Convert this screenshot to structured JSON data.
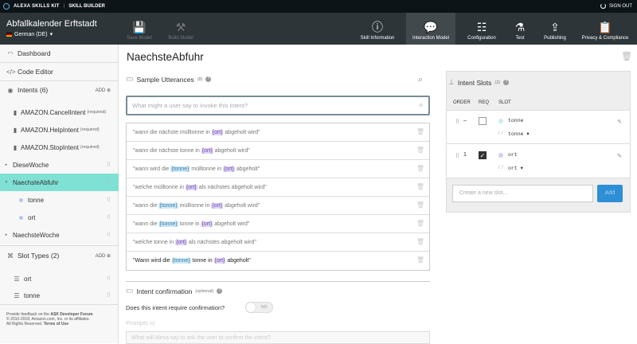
{
  "topbar": {
    "brand": "ALEXA SKILLS KIT",
    "section": "SKILL BUILDER",
    "signout": "SIGN OUT"
  },
  "header": {
    "skill_name": "Abfallkalender Erftstadt",
    "language": "German (DE)",
    "save_label": "Save Model",
    "build_label": "Build Model",
    "tabs": [
      "Skill Information",
      "Interaction Model",
      "Configuration",
      "Test",
      "Publishing",
      "Privacy & Compliance"
    ]
  },
  "sidebar": {
    "dashboard": "Dashboard",
    "code_editor": "Code Editor",
    "intents_header": "Intents (6)",
    "add": "ADD",
    "intents": [
      {
        "label": "AMAZON.CancelIntent",
        "req": "(required)"
      },
      {
        "label": "AMAZON.HelpIntent",
        "req": "(required)"
      },
      {
        "label": "AMAZON.StopIntent",
        "req": "(required)"
      },
      {
        "label": "DieseWoche"
      },
      {
        "label": "NaechsteAbfuhr"
      },
      {
        "label": "tonne"
      },
      {
        "label": "ort"
      },
      {
        "label": "NaechsteWoche"
      }
    ],
    "slot_types_header": "Slot Types (2)",
    "slot_types": [
      "ort",
      "tonne"
    ],
    "footer": {
      "line1a": "Provide feedback on the ",
      "line1b": "ASK Developer Forum",
      "line2": "© 2010-2018, Amazon.com, Inc. or its affiliates.",
      "line3a": "All Rights Reserved. ",
      "line3b": "Terms of Use"
    }
  },
  "main": {
    "title": "NaechsteAbfuhr",
    "utterances_title": "Sample Utterances",
    "utterances_count": "(8)",
    "utterance_placeholder": "What might a user say to invoke this intent?",
    "utterances": [
      [
        "\"wann die nächste mülltonne in ",
        "{ort}",
        "p",
        " abgeholt wird\""
      ],
      [
        "\"wann die nächste tonne in ",
        "{ort}",
        "p",
        " abgeholt wird\""
      ],
      [
        "\"wann wird die ",
        "{tonne}",
        "b",
        " mülltonne in ",
        "{ort}",
        "p",
        " abgeholt\""
      ],
      [
        "\"welche mülltonne in ",
        "{ort}",
        "p",
        " als nächstes abgeholt wird\""
      ],
      [
        "\"wann die ",
        "{tonne}",
        "b",
        " mülltonne in ",
        "{ort}",
        "p",
        " abgeholt wird\""
      ],
      [
        "\"wann die ",
        "{tonne}",
        "b",
        " tonne in ",
        "{ort}",
        "p",
        " abgeholt wird\""
      ],
      [
        "\"welche tonne in ",
        "{ort}",
        "p",
        " als nächstes abgeholt wird\""
      ],
      [
        "\"Wann wird die ",
        "{tonne}",
        "b",
        " tonne in ",
        "{ort}",
        "p",
        " abgeholt\""
      ]
    ],
    "confirmation_title": "Intent confirmation",
    "confirmation_optional": "(optional)",
    "confirmation_question": "Does this intent require confirmation?",
    "toggle_label": "NO",
    "prompts_label": "Prompts",
    "prompts_count": "(0)",
    "prompt_placeholder": "What will Alexa say to ask the user to confirm the intent?"
  },
  "slots_panel": {
    "title": "Intent Slots",
    "count": "(2)",
    "headers": [
      "ORDER",
      "REQ",
      "SLOT"
    ],
    "rows": [
      {
        "order": "–",
        "req": false,
        "name": "tonne",
        "type": "tonne",
        "color": "#cfe9f7"
      },
      {
        "order": "1",
        "req": true,
        "name": "ort",
        "type": "ort",
        "color": "#d9ccf3"
      }
    ],
    "new_slot_placeholder": "Create a new slot...",
    "add_button": "Add"
  }
}
